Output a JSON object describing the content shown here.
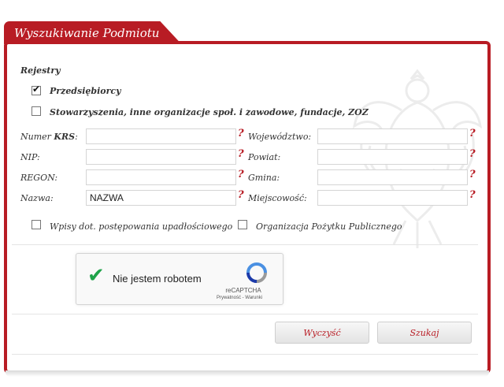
{
  "form_title": "Wyszukiwanie Podmiotu",
  "registers": {
    "heading": "Rejestry",
    "entrepreneurs": {
      "label": "Przedsiębiorcy",
      "checked": true
    },
    "associations": {
      "label": "Stowarzyszenia, inne organizacje społ. i zawodowe, fundacje, ZOZ",
      "checked": false
    }
  },
  "fields": {
    "krs": {
      "label_prefix": "Numer ",
      "label_bold": "KRS",
      "label_suffix": ":",
      "value": ""
    },
    "nip": {
      "label": "NIP:",
      "value": ""
    },
    "regon": {
      "label": "REGON:",
      "value": ""
    },
    "name": {
      "label": "Nazwa:",
      "value": "NAZWA"
    },
    "voivodeship": {
      "label": "Województwo:",
      "value": ""
    },
    "county": {
      "label": "Powiat:",
      "value": ""
    },
    "municipality": {
      "label": "Gmina:",
      "value": ""
    },
    "locality": {
      "label": "Miejscowość:",
      "value": ""
    }
  },
  "help_symbol": "?",
  "options": {
    "bankruptcy": {
      "label": "Wpisy dot. postępowania upadłościowego",
      "checked": false
    },
    "public_benefit": {
      "label": "Organizacja Pożytku Publicznego",
      "checked": false
    }
  },
  "captcha": {
    "text": "Nie jestem robotem",
    "brand": "reCAPTCHA",
    "links": "Prywatność - Warunki"
  },
  "buttons": {
    "clear": "Wyczyść",
    "search": "Szukaj"
  },
  "colors": {
    "accent": "#b81c24",
    "check_green": "#1fa34a"
  }
}
